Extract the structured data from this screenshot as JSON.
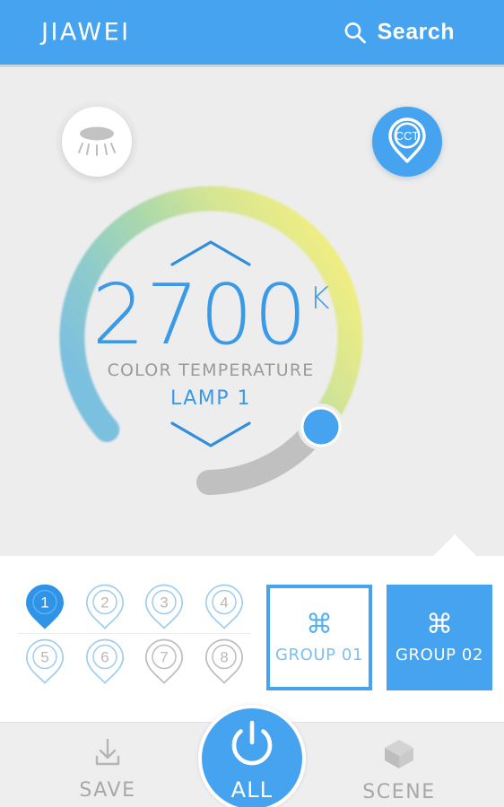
{
  "header": {
    "logo": "JIAWEI",
    "search_label": "Search",
    "search_icon": "search-icon",
    "background_color": "#46a3ef"
  },
  "mode_buttons": {
    "lamp": {
      "icon": "downlight-lamp-icon",
      "active": false
    },
    "cct": {
      "icon": "cct-pin-icon",
      "label": "CCT",
      "active": true
    }
  },
  "dial": {
    "value": "2700",
    "unit": "K",
    "caption": "COLOR TEMPERATURE",
    "target": "LAMP  1",
    "increase_icon": "chevron-up-icon",
    "decrease_icon": "chevron-down-icon",
    "accent_color": "#3a9ae8",
    "track_color": "#bfbfbf",
    "gradient_stops": [
      "#7fc3e0",
      "#8fcfc0",
      "#b9dfa1",
      "#e2e98e",
      "#f5ef80"
    ]
  },
  "panel": {
    "pins": [
      {
        "label": "1",
        "state": "selected"
      },
      {
        "label": "2",
        "state": "available"
      },
      {
        "label": "3",
        "state": "available"
      },
      {
        "label": "4",
        "state": "available"
      },
      {
        "label": "5",
        "state": "available"
      },
      {
        "label": "6",
        "state": "available"
      },
      {
        "label": "7",
        "state": "disabled"
      },
      {
        "label": "8",
        "state": "disabled"
      }
    ],
    "groups": [
      {
        "label": "GROUP 01",
        "glyph": "⌘",
        "icon": "group-clover-icon",
        "selected": false
      },
      {
        "label": "GROUP 02",
        "glyph": "⌘",
        "icon": "group-clover-icon",
        "selected": true
      }
    ]
  },
  "navbar": {
    "save": {
      "label": "SAVE",
      "icon": "download-save-icon"
    },
    "all": {
      "label": "ALL",
      "icon": "power-icon"
    },
    "scene": {
      "label": "SCENE",
      "icon": "cube-scene-icon"
    }
  }
}
